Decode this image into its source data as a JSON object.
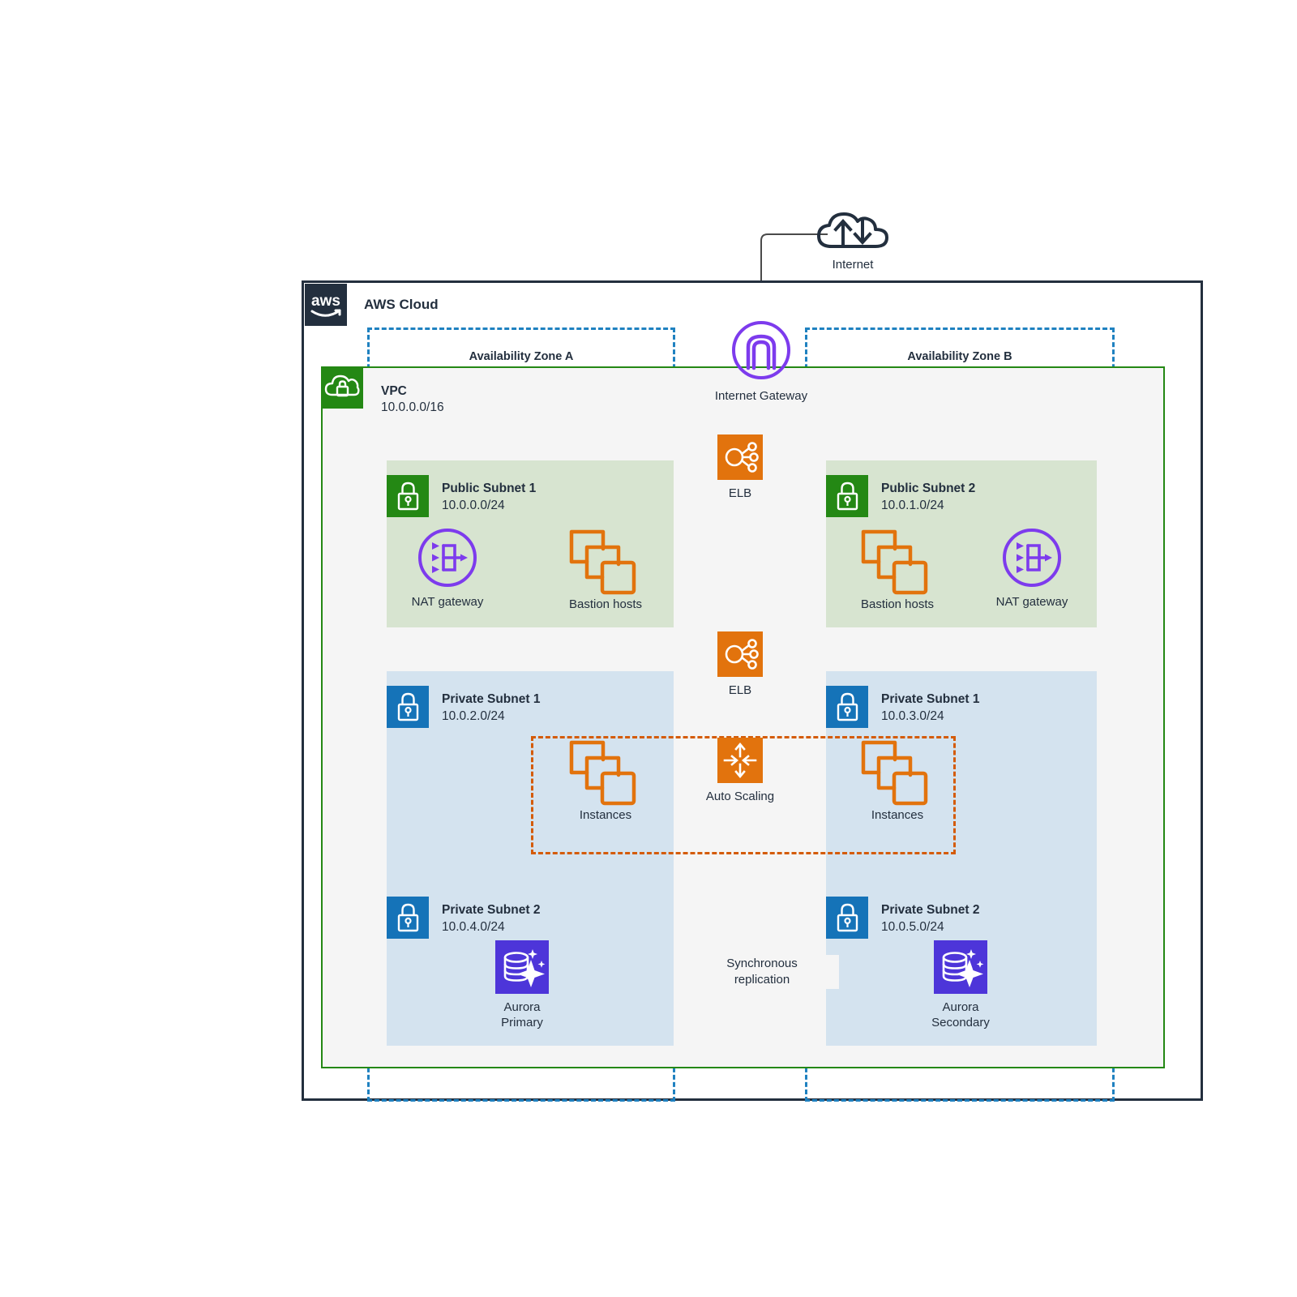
{
  "diagram": {
    "title": "AWS Cloud",
    "internet": {
      "label": "Internet",
      "icon": "internet-cloud-icon"
    },
    "internet_gateway": {
      "label": "Internet Gateway",
      "icon": "internet-gateway-icon"
    },
    "aws_cloud": {
      "label": "AWS Cloud",
      "logo": "aws-logo-icon"
    },
    "availability_zones": [
      {
        "label": "Availability Zone A"
      },
      {
        "label": "Availability Zone B"
      }
    ],
    "vpc": {
      "name": "VPC",
      "cidr": "10.0.0.0/16",
      "icon": "vpc-cloud-lock-icon"
    },
    "subnets": [
      {
        "name": "Public Subnet 1",
        "cidr": "10.0.0.0/24",
        "type": "public",
        "icon": "public-subnet-lock-icon"
      },
      {
        "name": "Public Subnet 2",
        "cidr": "10.0.1.0/24",
        "type": "public",
        "icon": "public-subnet-lock-icon"
      },
      {
        "name": "Private Subnet 1",
        "cidr": "10.0.2.0/24",
        "type": "private",
        "icon": "private-subnet-lock-icon"
      },
      {
        "name": "Private Subnet 1",
        "cidr": "10.0.3.0/24",
        "type": "private",
        "icon": "private-subnet-lock-icon"
      },
      {
        "name": "Private Subnet 2",
        "cidr": "10.0.4.0/24",
        "type": "private",
        "icon": "private-subnet-lock-icon"
      },
      {
        "name": "Private Subnet 2",
        "cidr": "10.0.5.0/24",
        "type": "private",
        "icon": "private-subnet-lock-icon"
      }
    ],
    "nodes": {
      "elb_public": {
        "label": "ELB",
        "icon": "elastic-load-balancer-icon"
      },
      "elb_private": {
        "label": "ELB",
        "icon": "elastic-load-balancer-icon"
      },
      "nat_a": {
        "label": "NAT gateway",
        "icon": "nat-gateway-icon"
      },
      "nat_b": {
        "label": "NAT gateway",
        "icon": "nat-gateway-icon"
      },
      "bastion_a": {
        "label": "Bastion hosts",
        "icon": "ec2-instances-icon"
      },
      "bastion_b": {
        "label": "Bastion hosts",
        "icon": "ec2-instances-icon"
      },
      "instances_a": {
        "label": "Instances",
        "icon": "ec2-instances-icon"
      },
      "instances_b": {
        "label": "Instances",
        "icon": "ec2-instances-icon"
      },
      "auto_scaling": {
        "label": "Auto Scaling",
        "icon": "auto-scaling-icon"
      },
      "aurora_primary": {
        "label_line1": "Aurora",
        "label_line2": "Primary",
        "icon": "aurora-database-icon"
      },
      "aurora_secondary": {
        "label_line1": "Aurora",
        "label_line2": "Secondary",
        "icon": "aurora-database-icon"
      }
    },
    "connections": [
      {
        "label_line1": "Synchronous",
        "label_line2": "replication",
        "style": "dashed-arrow"
      }
    ],
    "colors": {
      "aws_navy": "#232f3e",
      "vpc_green": "#248814",
      "az_blue": "#1f81c0",
      "subnet_green_bg": "#d7e4d0",
      "subnet_blue_bg": "#d4e3ef",
      "orange": "#e2730d",
      "asg_orange": "#d45b07",
      "purple": "#7d3bed",
      "aurora_blue": "#4d35d9",
      "private_subnet_blue": "#1573b8",
      "vpc_bg": "#f5f5f5"
    }
  }
}
